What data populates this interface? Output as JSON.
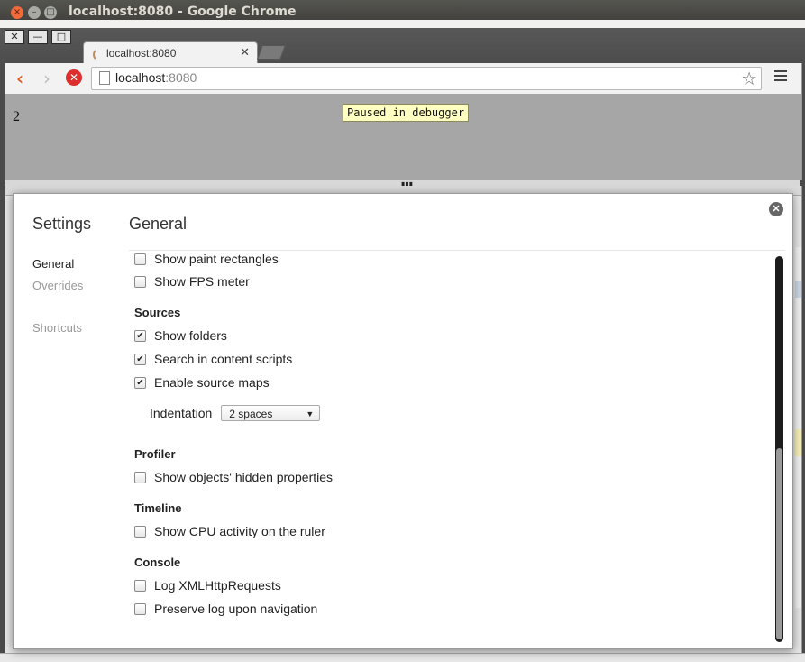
{
  "window": {
    "title": "localhost:8080 - Google Chrome"
  },
  "browser": {
    "tab_title": "localhost:8080",
    "url_host": "localhost",
    "url_port": ":8080",
    "controls": {
      "close": "✕",
      "minimize": "—",
      "maximize": "□"
    }
  },
  "page": {
    "text": "2",
    "paused_badge": "Paused in debugger"
  },
  "settings": {
    "title": "Settings",
    "nav": [
      {
        "label": "General",
        "active": true
      },
      {
        "label": "Overrides",
        "active": false
      },
      {
        "label": "Shortcuts",
        "active": false
      }
    ],
    "section_title": "General",
    "rows": {
      "paint_rects": {
        "label": "Show paint rectangles",
        "checked": false
      },
      "fps_meter": {
        "label": "Show FPS meter",
        "checked": false
      }
    },
    "groups": {
      "sources": {
        "title": "Sources",
        "items": [
          {
            "label": "Show folders",
            "checked": true
          },
          {
            "label": "Search in content scripts",
            "checked": true
          },
          {
            "label": "Enable source maps",
            "checked": true
          }
        ],
        "indentation_label": "Indentation",
        "indentation_value": "2 spaces"
      },
      "profiler": {
        "title": "Profiler",
        "items": [
          {
            "label": "Show objects' hidden properties",
            "checked": false
          }
        ]
      },
      "timeline": {
        "title": "Timeline",
        "items": [
          {
            "label": "Show CPU activity on the ruler",
            "checked": false
          }
        ]
      },
      "console": {
        "title": "Console",
        "items": [
          {
            "label": "Log XMLHttpRequests",
            "checked": false
          },
          {
            "label": "Preserve log upon navigation",
            "checked": false
          }
        ]
      }
    }
  },
  "colors": {
    "accent_back": "#e0622a",
    "stop": "#dd2e2e",
    "paused_bg": "#ffffc2",
    "page_bg": "#a6a6a6"
  }
}
